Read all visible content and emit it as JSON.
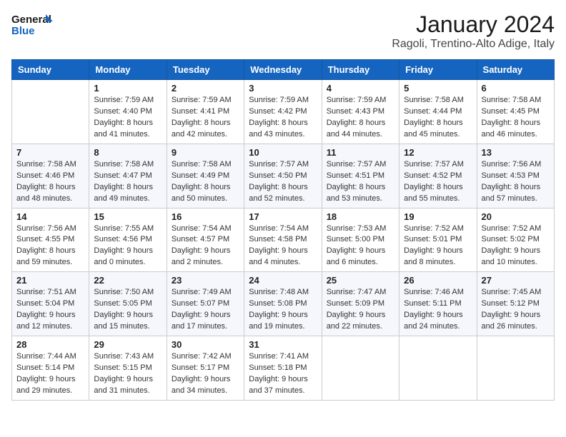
{
  "header": {
    "logo_line1": "General",
    "logo_line2": "Blue",
    "month": "January 2024",
    "location": "Ragoli, Trentino-Alto Adige, Italy"
  },
  "weekdays": [
    "Sunday",
    "Monday",
    "Tuesday",
    "Wednesday",
    "Thursday",
    "Friday",
    "Saturday"
  ],
  "weeks": [
    [
      {
        "day": "",
        "sunrise": "",
        "sunset": "",
        "daylight": ""
      },
      {
        "day": "1",
        "sunrise": "7:59 AM",
        "sunset": "4:40 PM",
        "daylight": "8 hours and 41 minutes."
      },
      {
        "day": "2",
        "sunrise": "7:59 AM",
        "sunset": "4:41 PM",
        "daylight": "8 hours and 42 minutes."
      },
      {
        "day": "3",
        "sunrise": "7:59 AM",
        "sunset": "4:42 PM",
        "daylight": "8 hours and 43 minutes."
      },
      {
        "day": "4",
        "sunrise": "7:59 AM",
        "sunset": "4:43 PM",
        "daylight": "8 hours and 44 minutes."
      },
      {
        "day": "5",
        "sunrise": "7:58 AM",
        "sunset": "4:44 PM",
        "daylight": "8 hours and 45 minutes."
      },
      {
        "day": "6",
        "sunrise": "7:58 AM",
        "sunset": "4:45 PM",
        "daylight": "8 hours and 46 minutes."
      }
    ],
    [
      {
        "day": "7",
        "sunrise": "7:58 AM",
        "sunset": "4:46 PM",
        "daylight": "8 hours and 48 minutes."
      },
      {
        "day": "8",
        "sunrise": "7:58 AM",
        "sunset": "4:47 PM",
        "daylight": "8 hours and 49 minutes."
      },
      {
        "day": "9",
        "sunrise": "7:58 AM",
        "sunset": "4:49 PM",
        "daylight": "8 hours and 50 minutes."
      },
      {
        "day": "10",
        "sunrise": "7:57 AM",
        "sunset": "4:50 PM",
        "daylight": "8 hours and 52 minutes."
      },
      {
        "day": "11",
        "sunrise": "7:57 AM",
        "sunset": "4:51 PM",
        "daylight": "8 hours and 53 minutes."
      },
      {
        "day": "12",
        "sunrise": "7:57 AM",
        "sunset": "4:52 PM",
        "daylight": "8 hours and 55 minutes."
      },
      {
        "day": "13",
        "sunrise": "7:56 AM",
        "sunset": "4:53 PM",
        "daylight": "8 hours and 57 minutes."
      }
    ],
    [
      {
        "day": "14",
        "sunrise": "7:56 AM",
        "sunset": "4:55 PM",
        "daylight": "8 hours and 59 minutes."
      },
      {
        "day": "15",
        "sunrise": "7:55 AM",
        "sunset": "4:56 PM",
        "daylight": "9 hours and 0 minutes."
      },
      {
        "day": "16",
        "sunrise": "7:54 AM",
        "sunset": "4:57 PM",
        "daylight": "9 hours and 2 minutes."
      },
      {
        "day": "17",
        "sunrise": "7:54 AM",
        "sunset": "4:58 PM",
        "daylight": "9 hours and 4 minutes."
      },
      {
        "day": "18",
        "sunrise": "7:53 AM",
        "sunset": "5:00 PM",
        "daylight": "9 hours and 6 minutes."
      },
      {
        "day": "19",
        "sunrise": "7:52 AM",
        "sunset": "5:01 PM",
        "daylight": "9 hours and 8 minutes."
      },
      {
        "day": "20",
        "sunrise": "7:52 AM",
        "sunset": "5:02 PM",
        "daylight": "9 hours and 10 minutes."
      }
    ],
    [
      {
        "day": "21",
        "sunrise": "7:51 AM",
        "sunset": "5:04 PM",
        "daylight": "9 hours and 12 minutes."
      },
      {
        "day": "22",
        "sunrise": "7:50 AM",
        "sunset": "5:05 PM",
        "daylight": "9 hours and 15 minutes."
      },
      {
        "day": "23",
        "sunrise": "7:49 AM",
        "sunset": "5:07 PM",
        "daylight": "9 hours and 17 minutes."
      },
      {
        "day": "24",
        "sunrise": "7:48 AM",
        "sunset": "5:08 PM",
        "daylight": "9 hours and 19 minutes."
      },
      {
        "day": "25",
        "sunrise": "7:47 AM",
        "sunset": "5:09 PM",
        "daylight": "9 hours and 22 minutes."
      },
      {
        "day": "26",
        "sunrise": "7:46 AM",
        "sunset": "5:11 PM",
        "daylight": "9 hours and 24 minutes."
      },
      {
        "day": "27",
        "sunrise": "7:45 AM",
        "sunset": "5:12 PM",
        "daylight": "9 hours and 26 minutes."
      }
    ],
    [
      {
        "day": "28",
        "sunrise": "7:44 AM",
        "sunset": "5:14 PM",
        "daylight": "9 hours and 29 minutes."
      },
      {
        "day": "29",
        "sunrise": "7:43 AM",
        "sunset": "5:15 PM",
        "daylight": "9 hours and 31 minutes."
      },
      {
        "day": "30",
        "sunrise": "7:42 AM",
        "sunset": "5:17 PM",
        "daylight": "9 hours and 34 minutes."
      },
      {
        "day": "31",
        "sunrise": "7:41 AM",
        "sunset": "5:18 PM",
        "daylight": "9 hours and 37 minutes."
      },
      {
        "day": "",
        "sunrise": "",
        "sunset": "",
        "daylight": ""
      },
      {
        "day": "",
        "sunrise": "",
        "sunset": "",
        "daylight": ""
      },
      {
        "day": "",
        "sunrise": "",
        "sunset": "",
        "daylight": ""
      }
    ]
  ],
  "labels": {
    "sunrise_prefix": "Sunrise: ",
    "sunset_prefix": "Sunset: ",
    "daylight_prefix": "Daylight: "
  }
}
